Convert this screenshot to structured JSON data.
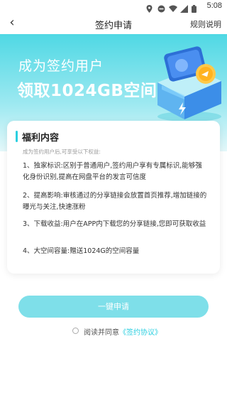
{
  "status_bar": {
    "time": "5:08"
  },
  "nav": {
    "back_icon": "‹",
    "title": "签约申请",
    "rules_label": "规则说明"
  },
  "hero": {
    "line1": "成为签约用户",
    "line2": "领取1024GB空间"
  },
  "benefits": {
    "heading": "福利内容",
    "subtitle": "成为签约用户后,可享受以下权益:",
    "items": [
      {
        "text": "1、独家标识:区别于普通用户,签约用户享有专属标识,能够强化身份识别,提高在网盘平台的发言可信度"
      },
      {
        "text": "2、提高影响:审核通过的分享链接会放置首页推荐,增加链接的曝光与关注,快速涨粉"
      },
      {
        "text": "3、下载收益:用户在APP内下载您的分享链接,您即可获取收益"
      },
      {
        "text": "4、大空间容量:赠送1024G的空间容量"
      }
    ]
  },
  "apply_button": {
    "label": "一键申请"
  },
  "agreement": {
    "prefix": "阅读并同意",
    "link": "《签约协议》"
  },
  "colors": {
    "accent": "#2bcfe0",
    "button": "#7edfe9",
    "hero_top": "#4fd8e4"
  }
}
